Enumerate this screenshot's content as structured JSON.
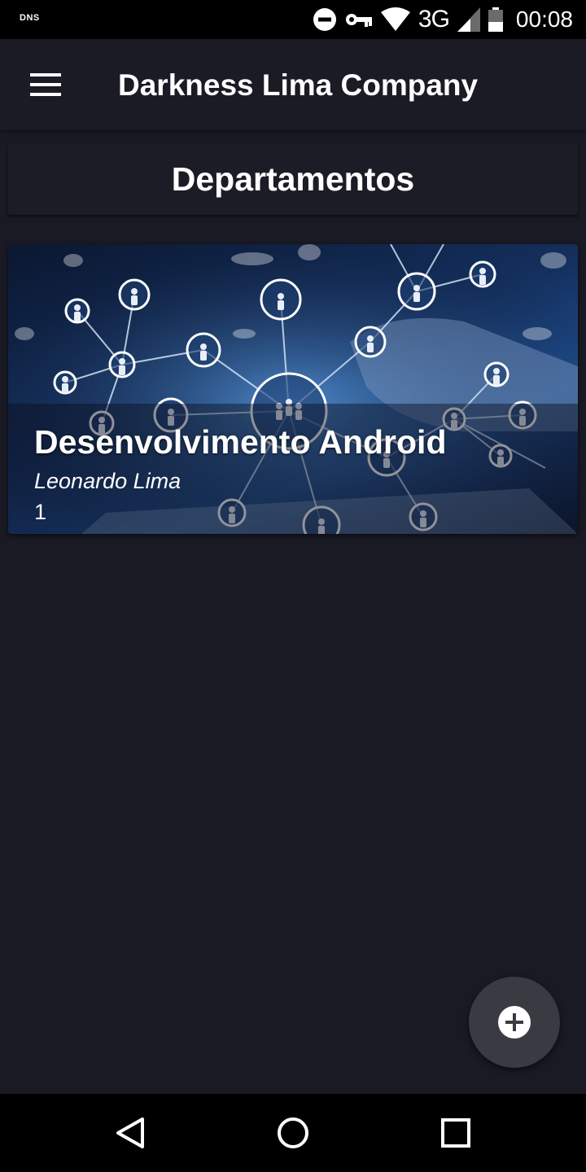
{
  "status_bar": {
    "left_label": "DNS",
    "network": "3G",
    "time": "00:08",
    "icons": [
      "do-not-disturb-icon",
      "vpn-key-icon",
      "wifi-icon",
      "signal-icon",
      "battery-icon"
    ]
  },
  "app_bar": {
    "title": "Darkness Lima Company",
    "menu_icon": "hamburger-menu-icon"
  },
  "section": {
    "title": "Departamentos"
  },
  "departments": [
    {
      "name": "Desenvolvimento Android",
      "manager": "Leonardo Lima",
      "count": "1"
    }
  ],
  "fab": {
    "icon": "add-circle-icon"
  },
  "nav_bar": {
    "icons": [
      "back-triangle-icon",
      "home-circle-icon",
      "recents-square-icon"
    ]
  },
  "colors": {
    "background": "#1a1a24",
    "app_bar": "#1a1b25",
    "fab": "#3a3b42",
    "system_bars": "#000000",
    "text": "#ffffff"
  }
}
